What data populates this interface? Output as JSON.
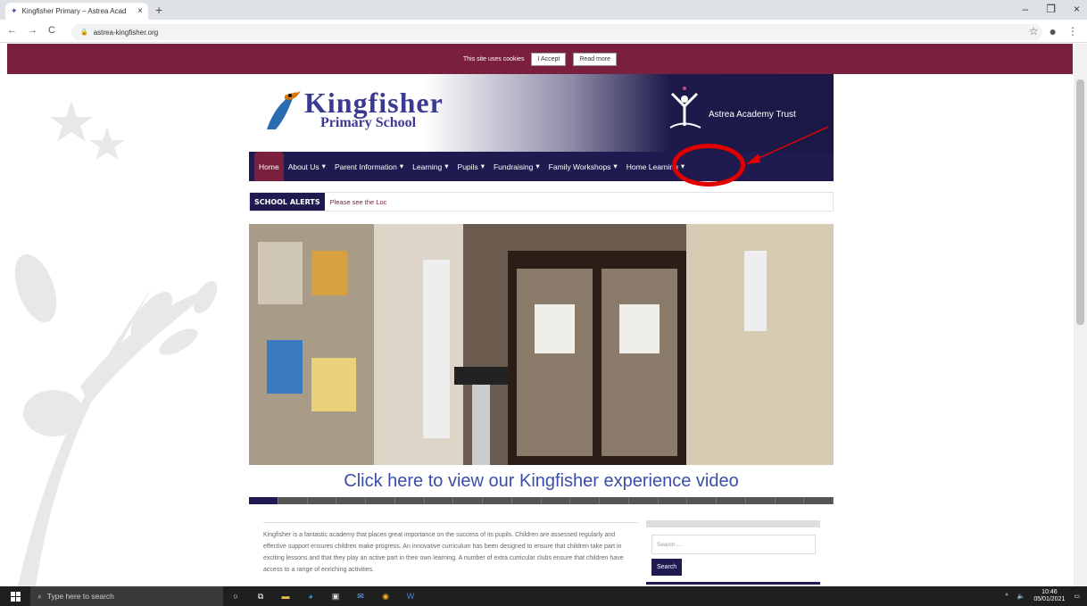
{
  "browser": {
    "tab_title": "Kingfisher Primary – Astrea Acad",
    "tab_close": "×",
    "new_tab": "+",
    "url": "astrea-kingfisher.org",
    "window_controls": [
      "–",
      "❐",
      "×"
    ]
  },
  "cookie_bar": {
    "text": "This site uses cookies",
    "accept_label": "I Accept",
    "read_more_label": "Read more"
  },
  "header": {
    "school_name": "Kingfisher",
    "school_sub": "Primary School",
    "trust_name": "Astrea Academy Trust"
  },
  "nav": {
    "items": [
      {
        "label": "Home",
        "active": true,
        "dropdown": false
      },
      {
        "label": "About Us",
        "active": false,
        "dropdown": true
      },
      {
        "label": "Parent Information",
        "active": false,
        "dropdown": true
      },
      {
        "label": "Learning",
        "active": false,
        "dropdown": true
      },
      {
        "label": "Pupils",
        "active": false,
        "dropdown": true
      },
      {
        "label": "Fundraising",
        "active": false,
        "dropdown": true
      },
      {
        "label": "Family Workshops",
        "active": false,
        "dropdown": true
      },
      {
        "label": "Home Learning",
        "active": false,
        "dropdown": true
      }
    ]
  },
  "alerts": {
    "tag": "SCHOOL ALERTS",
    "message": "Please see the Loc"
  },
  "hero": {
    "caption": "Click here to view our Kingfisher experience video"
  },
  "intro": {
    "text": "Kingfisher is a fantastic academy that places great importance on the success of its pupils. Children are assessed regularly and effective support ensures children make progress. An innovative curriculum has been designed to ensure that children take part in exciting lessons and that they play an active part in their own learning. A number of extra curricular clubs ensure that children have access to a range of enriching activities."
  },
  "sidebar": {
    "search_placeholder": "Search ...",
    "search_button": "Search"
  },
  "taskbar": {
    "search_placeholder": "Type here to search",
    "time": "10:46",
    "date": "05/01/2021"
  },
  "colors": {
    "maroon": "#7a1f3d",
    "navy": "#1f1a4f",
    "annotation_red": "#e10000"
  }
}
